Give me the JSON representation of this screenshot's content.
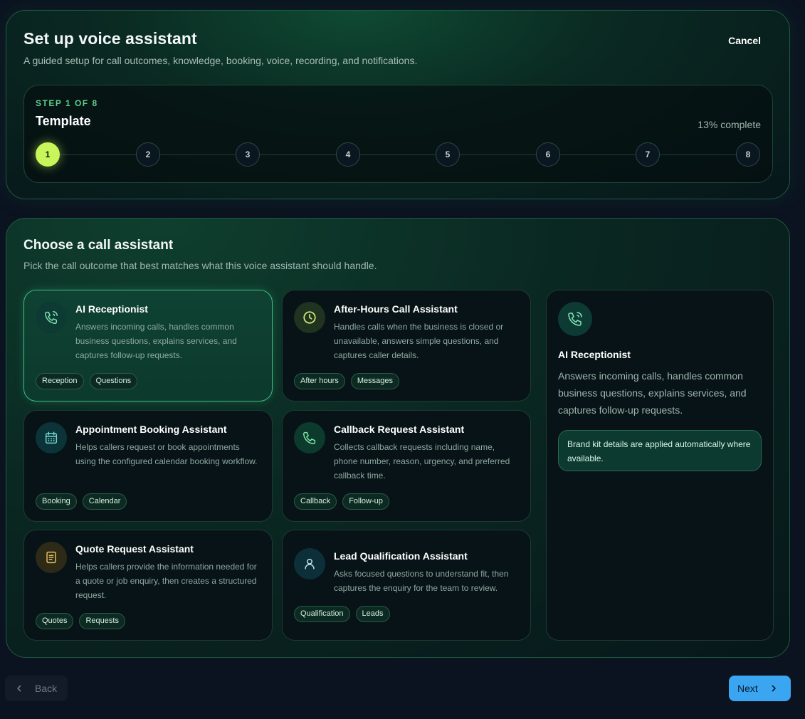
{
  "header": {
    "title": "Set up voice assistant",
    "subtitle": "A guided setup for call outcomes, knowledge, booking, voice, recording, and notifications.",
    "cancel_label": "Cancel"
  },
  "stepper": {
    "step_label": "STEP 1 OF 8",
    "step_name": "Template",
    "progress_text": "13% complete",
    "current_step": 1,
    "steps": [
      "1",
      "2",
      "3",
      "4",
      "5",
      "6",
      "7",
      "8"
    ]
  },
  "main": {
    "title": "Choose a call assistant",
    "subtitle": "Pick the call outcome that best matches what this voice assistant should handle.",
    "options": [
      {
        "title": "AI Receptionist",
        "desc": "Answers incoming calls, handles common business questions, explains services, and captures follow-up requests.",
        "tags": [
          "Reception",
          "Questions"
        ],
        "icon": "phone-call-icon",
        "selected": true
      },
      {
        "title": "After-Hours Call Assistant",
        "desc": "Handles calls when the business is closed or unavailable, answers simple questions, and captures caller details.",
        "tags": [
          "After hours",
          "Messages"
        ],
        "icon": "clock-icon",
        "selected": false
      },
      {
        "title": "Appointment Booking Assistant",
        "desc": "Helps callers request or book appointments using the configured calendar booking workflow.",
        "tags": [
          "Booking",
          "Calendar"
        ],
        "icon": "calendar-icon",
        "selected": false
      },
      {
        "title": "Callback Request Assistant",
        "desc": "Collects callback requests including name, phone number, reason, urgency, and preferred callback time.",
        "tags": [
          "Callback",
          "Follow-up"
        ],
        "icon": "phone-icon",
        "selected": false
      },
      {
        "title": "Quote Request Assistant",
        "desc": "Helps callers provide the information needed for a quote or job enquiry, then creates a structured request.",
        "tags": [
          "Quotes",
          "Requests"
        ],
        "icon": "document-icon",
        "selected": false
      },
      {
        "title": "Lead Qualification Assistant",
        "desc": "Asks focused questions to understand fit, then captures the enquiry for the team to review.",
        "tags": [
          "Qualification",
          "Leads"
        ],
        "icon": "user-icon",
        "selected": false
      }
    ],
    "detail": {
      "title": "AI Receptionist",
      "desc": "Answers incoming calls, handles common business questions, explains services, and captures follow-up requests.",
      "note": "Brand kit details are applied automatically where available.",
      "icon": "phone-call-icon"
    }
  },
  "footer": {
    "back_label": "Back",
    "next_label": "Next"
  },
  "colors": {
    "accent_lime": "#c8f55a",
    "accent_green": "#3dbd84",
    "next_blue": "#3aa6f2",
    "background": "#0b1320"
  }
}
